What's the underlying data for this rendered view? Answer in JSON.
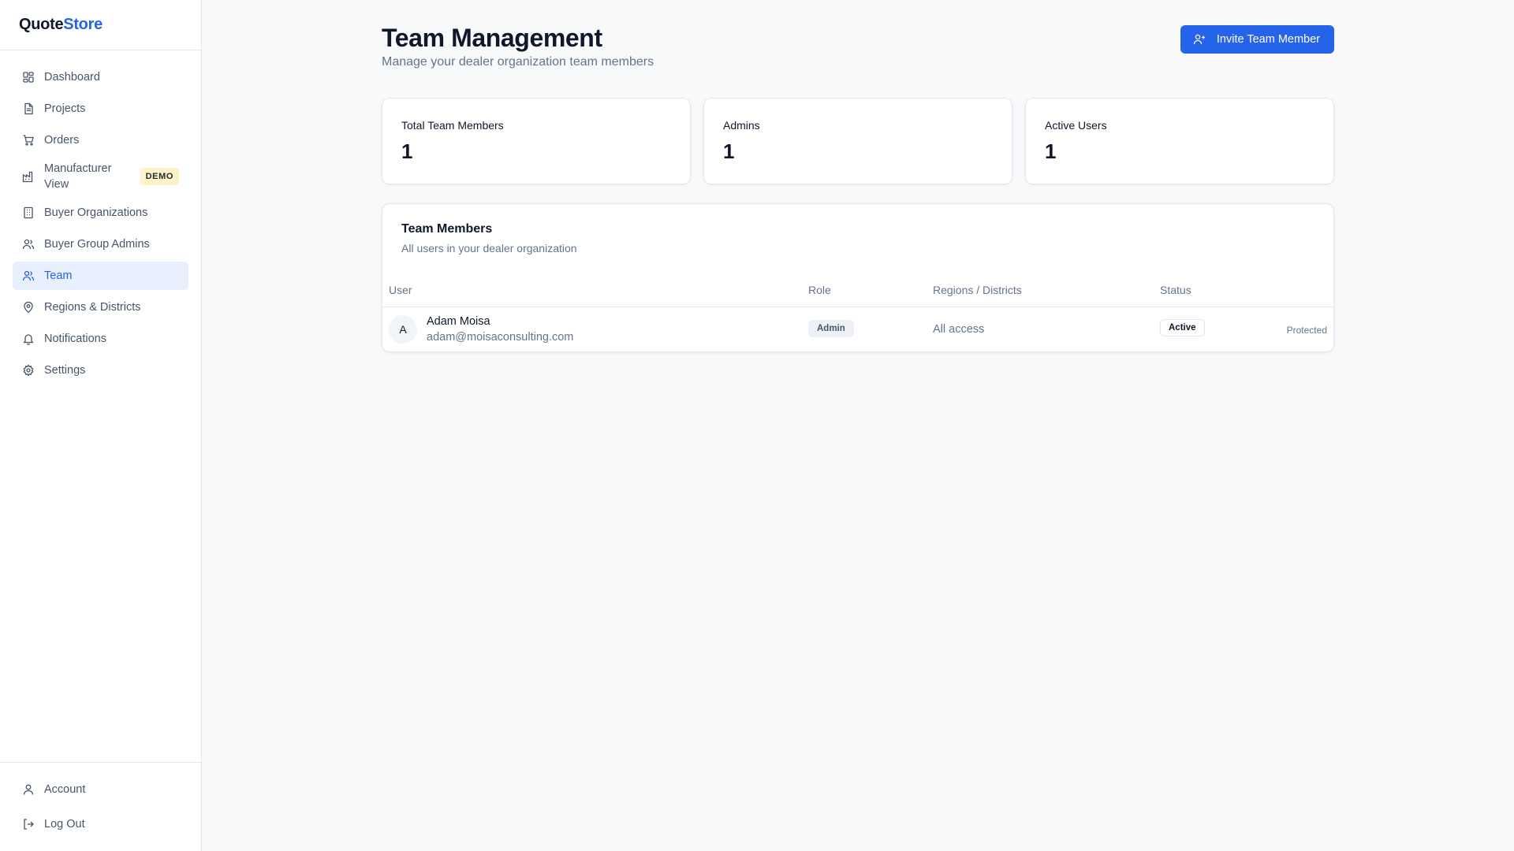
{
  "app": {
    "brand_part1": "Quote",
    "brand_part2": "Store"
  },
  "sidebar": {
    "items": [
      {
        "label": "Dashboard",
        "icon": "dashboard-icon"
      },
      {
        "label": "Projects",
        "icon": "document-icon"
      },
      {
        "label": "Orders",
        "icon": "cart-icon"
      },
      {
        "label": "Manufacturer View",
        "icon": "factory-icon",
        "badge": "DEMO"
      },
      {
        "label": "Buyer Organizations",
        "icon": "building-icon"
      },
      {
        "label": "Buyer Group Admins",
        "icon": "users-icon"
      },
      {
        "label": "Team",
        "icon": "users-icon",
        "active": true
      },
      {
        "label": "Regions & Districts",
        "icon": "map-pin-icon"
      },
      {
        "label": "Notifications",
        "icon": "bell-icon"
      },
      {
        "label": "Settings",
        "icon": "gear-icon"
      }
    ],
    "bottom": [
      {
        "label": "Account",
        "icon": "user-icon"
      },
      {
        "label": "Log Out",
        "icon": "logout-icon"
      }
    ]
  },
  "header": {
    "title": "Team Management",
    "subtitle": "Manage your dealer organization team members",
    "invite_label": "Invite Team Member"
  },
  "stats": [
    {
      "label": "Total Team Members",
      "value": "1"
    },
    {
      "label": "Admins",
      "value": "1"
    },
    {
      "label": "Active Users",
      "value": "1"
    }
  ],
  "team_table": {
    "title": "Team Members",
    "subtitle": "All users in your dealer organization",
    "columns": [
      "User",
      "Role",
      "Regions / Districts",
      "Status"
    ],
    "rows": [
      {
        "avatar_initial": "A",
        "name": "Adam Moisa",
        "email": "adam@moisaconsulting.com",
        "role": "Admin",
        "regions": "All access",
        "status": "Active",
        "action": "Protected"
      }
    ]
  },
  "colors": {
    "accent": "#2563eb",
    "active_nav_bg": "#e8effd",
    "demo_badge_bg": "#fef3c7"
  }
}
